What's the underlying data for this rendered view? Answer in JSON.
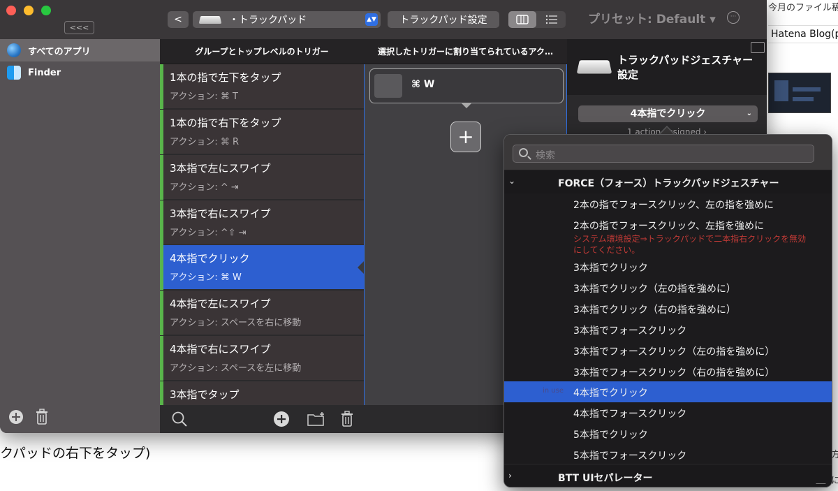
{
  "background": {
    "bottom_text": "クパッドの右下をタップ)",
    "right_top": "今月のファイル稿",
    "right_hatena": "Hatena Blog(p",
    "right_bits_1": "方",
    "right_bits_2": "に"
  },
  "window": {
    "collapse_label": "<<<",
    "sidebar": {
      "items": [
        {
          "label": "すべてのアプリ",
          "icon": "globe-icon",
          "active": true
        },
        {
          "label": "Finder",
          "icon": "finder-icon",
          "active": false
        }
      ]
    },
    "toolbar": {
      "back": "<",
      "device_select": "・トラックパッド",
      "settings": "トラックパッド設定",
      "preset": "プリセット: Default ▾",
      "more": "···"
    },
    "columns": {
      "triggers_header": "グループとトップレベルのトリガー",
      "actions_header": "選択したトリガーに割り当てられているアク…"
    },
    "triggers": [
      {
        "title": "1本の指で左下をタップ",
        "action": "アクション: ⌘ T"
      },
      {
        "title": "1本の指で右下をタップ",
        "action": "アクション: ⌘ R"
      },
      {
        "title": "3本指で左にスワイプ",
        "action": "アクション: ^ ⇥"
      },
      {
        "title": "3本指で右にスワイプ",
        "action": "アクション: ^⇧ ⇥"
      },
      {
        "title": "4本指でクリック",
        "action": "アクション: ⌘ W",
        "selected": true
      },
      {
        "title": "4本指で左にスワイプ",
        "action": "アクション: スペースを右に移動"
      },
      {
        "title": "4本指で右にスワイプ",
        "action": "アクション: スペースを左に移動"
      },
      {
        "title": "3本指でタップ",
        "action": ""
      }
    ],
    "action_card": {
      "label": "⌘ W"
    },
    "add_action": "+",
    "right_panel": {
      "title": "トラックパッドジェスチャー設定",
      "gesture_select": "4本指でクリック",
      "assigned": "1 action assigned ›"
    }
  },
  "dropdown": {
    "search_placeholder": "検索",
    "group_force": "FORCE（フォース）トラックパッドジェスチャー",
    "items": [
      {
        "label": "2本の指でフォースクリック、左の指を強めに"
      },
      {
        "label": "2本の指でフォースクリック、左指を強めに",
        "warning": "システム環境設定⇒トラックパッドで二本指右クリックを無効にしてください。"
      },
      {
        "label": "3本指でクリック"
      },
      {
        "label": "3本指でクリック（左の指を強めに）"
      },
      {
        "label": "3本指でクリック（右の指を強めに）"
      },
      {
        "label": "3本指でフォースクリック"
      },
      {
        "label": "3本指でフォースクリック（左の指を強めに）"
      },
      {
        "label": "3本指でフォースクリック（右の指を強めに）"
      },
      {
        "label": "4本指でクリック",
        "selected": true,
        "badge": "in use"
      },
      {
        "label": "4本指でフォースクリック"
      },
      {
        "label": "5本指でクリック"
      },
      {
        "label": "5本指でフォースクリック"
      }
    ],
    "group_separator": "BTT UIセパレーター"
  },
  "colors": {
    "accent": "#2d5fd0",
    "trigger_bar": "#59b44b",
    "warning": "#c03a36"
  }
}
